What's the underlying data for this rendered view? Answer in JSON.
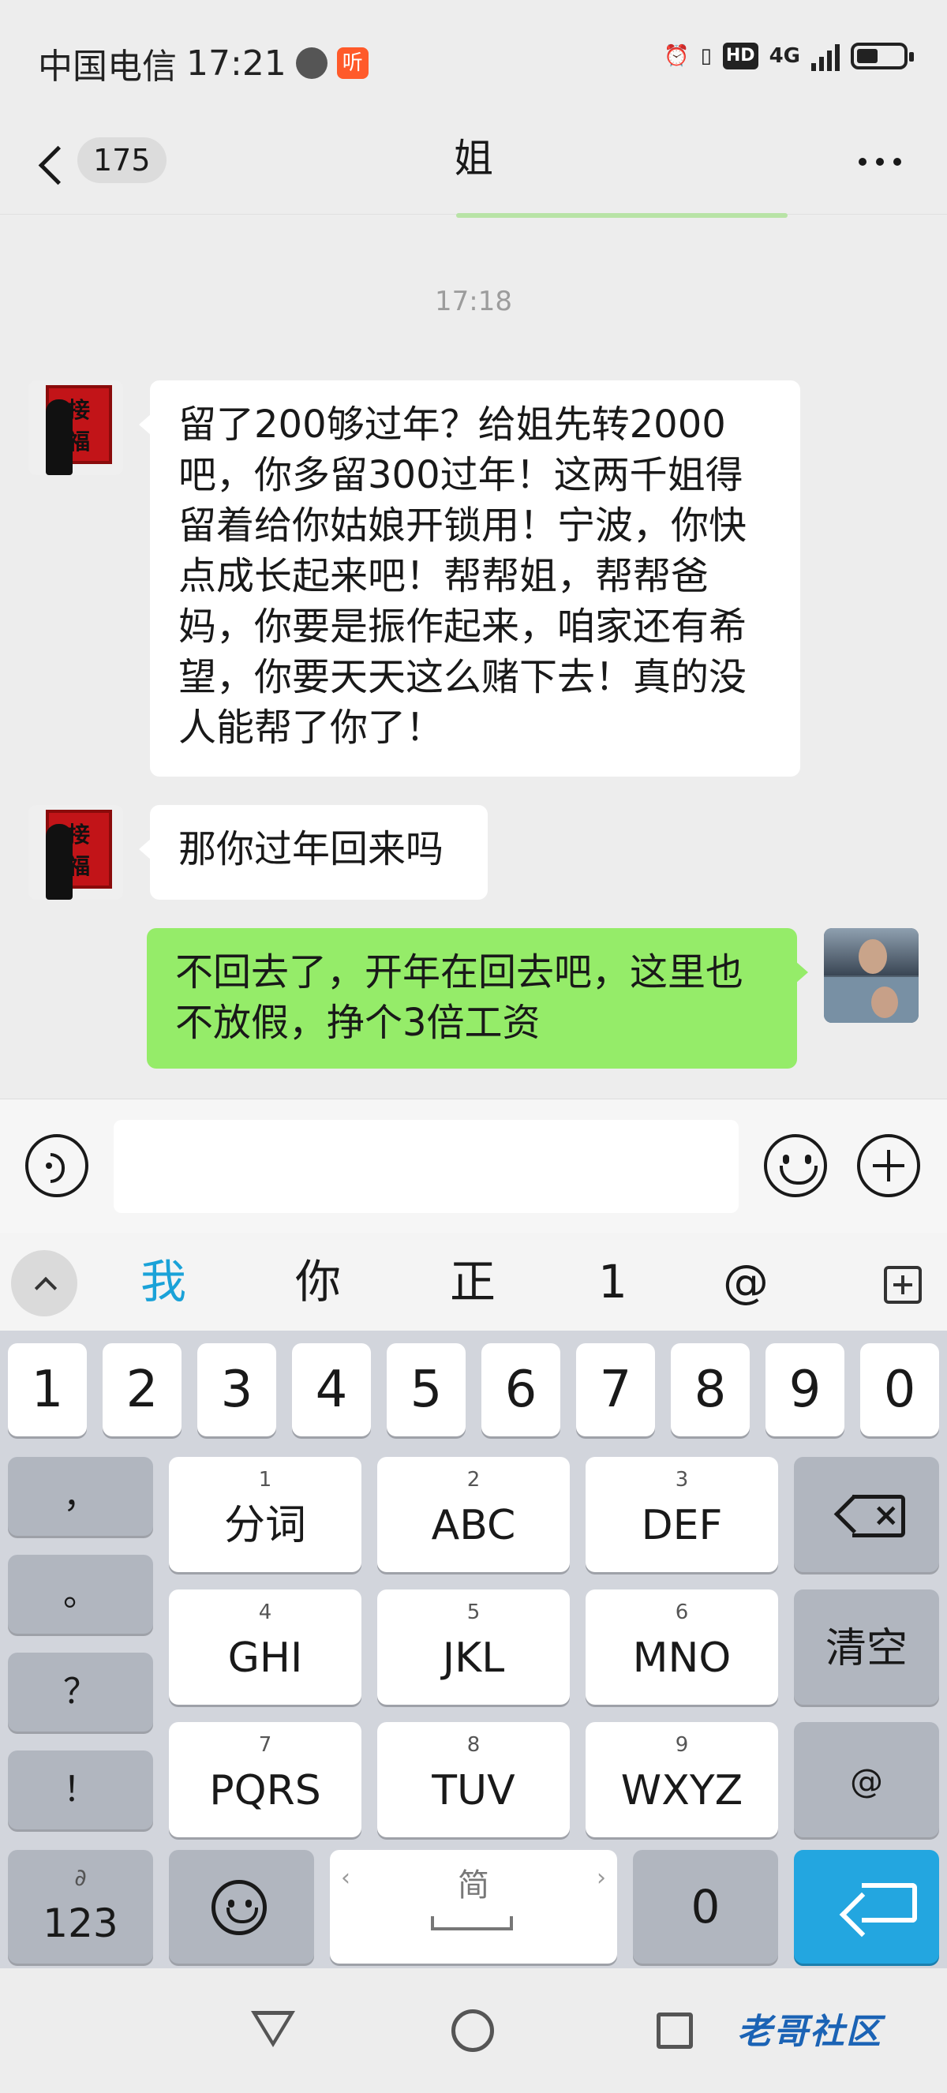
{
  "status_bar": {
    "carrier": "中国电信",
    "time": "17:21",
    "listen_badge": "听",
    "network": "4G",
    "hd": "HD"
  },
  "header": {
    "unread_count": "175",
    "title": "姐"
  },
  "messages": [
    {
      "time": "17:18"
    },
    {
      "side": "left",
      "text": "留了200够过年？给姐先转2000吧，你多留300过年！这两千姐得留着给你姑娘开锁用！宁波，你快点成长起来吧！帮帮姐，帮帮爸妈，你要是振作起来，咱家还有希望，你要天天这么赌下去！真的没人能帮了你了！"
    },
    {
      "side": "left",
      "text": "那你过年回来吗"
    },
    {
      "side": "right",
      "text": "不回去了，开年在回去吧，这里也不放假，挣个3倍工资"
    }
  ],
  "avatar_text": {
    "line1": "接",
    "line2": "福"
  },
  "candidates": [
    "我",
    "你",
    "正",
    "1",
    "@"
  ],
  "keyboard": {
    "digits": [
      "1",
      "2",
      "3",
      "4",
      "5",
      "6",
      "7",
      "8",
      "9",
      "0"
    ],
    "punct": [
      "，",
      "。",
      "？",
      "！"
    ],
    "t9": [
      {
        "num": "1",
        "label": "分词"
      },
      {
        "num": "2",
        "label": "ABC"
      },
      {
        "num": "3",
        "label": "DEF"
      },
      {
        "num": "4",
        "label": "GHI"
      },
      {
        "num": "5",
        "label": "JKL"
      },
      {
        "num": "6",
        "label": "MNO"
      },
      {
        "num": "7",
        "label": "PQRS"
      },
      {
        "num": "8",
        "label": "TUV"
      },
      {
        "num": "9",
        "label": "WXYZ"
      }
    ],
    "clear": "清空",
    "at": "@",
    "num_mode": "123",
    "num_mode_small": "∂",
    "space_label": "简",
    "zero": "0"
  },
  "watermark": "老哥社区",
  "icons": [
    "back-icon",
    "more-icon",
    "voice-icon",
    "emoji-icon",
    "plus-icon",
    "collapse-icon",
    "add-word-icon",
    "backspace-icon",
    "enter-icon",
    "smiley-icon",
    "nav-back-icon",
    "nav-home-icon",
    "nav-recent-icon"
  ]
}
